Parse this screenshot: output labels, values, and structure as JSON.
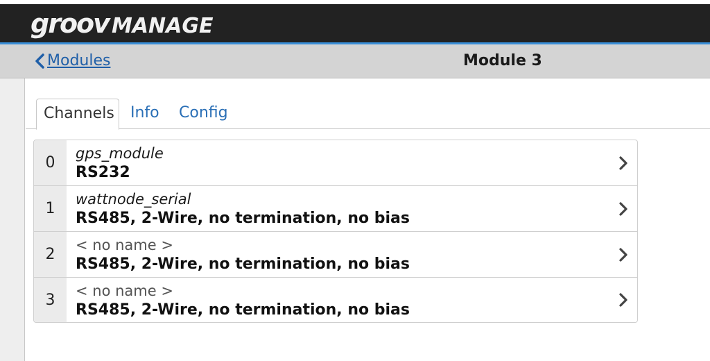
{
  "header": {
    "logo_groov": "groov",
    "logo_manage": "MANAGE"
  },
  "nav": {
    "back_label": "Modules",
    "title": "Module 3"
  },
  "tabs": [
    {
      "label": "Channels",
      "active": true
    },
    {
      "label": "Info",
      "active": false
    },
    {
      "label": "Config",
      "active": false
    }
  ],
  "channels": [
    {
      "index": "0",
      "name": "gps_module",
      "type": "RS232"
    },
    {
      "index": "1",
      "name": "wattnode_serial",
      "type": "RS485, 2-Wire, no termination, no bias"
    },
    {
      "index": "2",
      "name": "< no name >",
      "type": "RS485, 2-Wire, no termination, no bias"
    },
    {
      "index": "3",
      "name": "< no name >",
      "type": "RS485, 2-Wire, no termination, no bias"
    }
  ],
  "colors": {
    "accent": "#3a8fd8",
    "link": "#1f5fa8",
    "header_bg": "#222222"
  },
  "icons": {
    "back": "chevron-left-icon",
    "row_arrow": "chevron-right-icon"
  }
}
